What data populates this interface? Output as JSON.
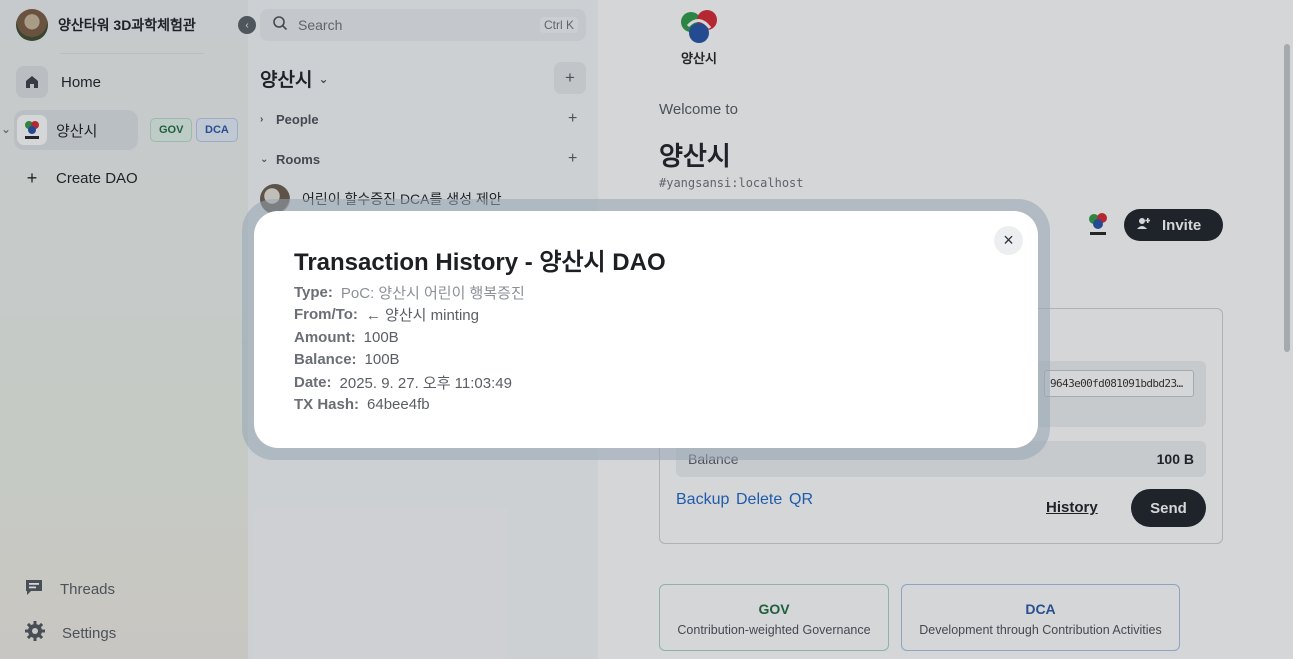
{
  "sidebar": {
    "title": "양산타워 3D과학체험관",
    "home_label": "Home",
    "dao_label": "양산시",
    "chip_gov": "GOV",
    "chip_dca": "DCA",
    "create_label": "Create DAO",
    "threads_label": "Threads",
    "settings_label": "Settings"
  },
  "rooms": {
    "search_placeholder": "Search",
    "search_shortcut": "Ctrl K",
    "space_title": "양산시",
    "people_label": "People",
    "rooms_label": "Rooms",
    "room_item": "어린이 할수증진 DCA를 생성 제안"
  },
  "main": {
    "logo_text": "양산시",
    "welcome": "Welcome to",
    "dao_name": "양산시",
    "alias": "#yangsansi:localhost",
    "invite_label": "Invite",
    "address": "9643e00fd081091bdbd23…",
    "balance_label": "Balance",
    "balance_value": "100 B",
    "backup_label": "Backup",
    "delete_label": "Delete",
    "qr_label": "QR",
    "history_label": "History",
    "send_label": "Send",
    "gov_title": "GOV",
    "gov_sub": "Contribution-weighted Governance",
    "dca_title": "DCA",
    "dca_sub": "Development through Contribution Activities"
  },
  "modal": {
    "title": "Transaction History - 양산시 DAO",
    "close_icon": "×",
    "rows": [
      {
        "key": "Type:",
        "value": "PoC: 양산시 어린이 행복증진"
      },
      {
        "key": "From/To:",
        "value": "← 양산시 minting"
      },
      {
        "key": "Amount:",
        "value": "100B"
      },
      {
        "key": "Balance:",
        "value": "100B"
      },
      {
        "key": "Date:",
        "value": "2025. 9. 27. 오후 11:03:49"
      },
      {
        "key": "TX Hash:",
        "value": "64bee4fb"
      }
    ]
  },
  "colors": {
    "accent_dark": "#1d2026",
    "link_blue": "#1f66c7",
    "gov_green": "#1f6b3e",
    "dca_blue": "#2a57a6"
  }
}
